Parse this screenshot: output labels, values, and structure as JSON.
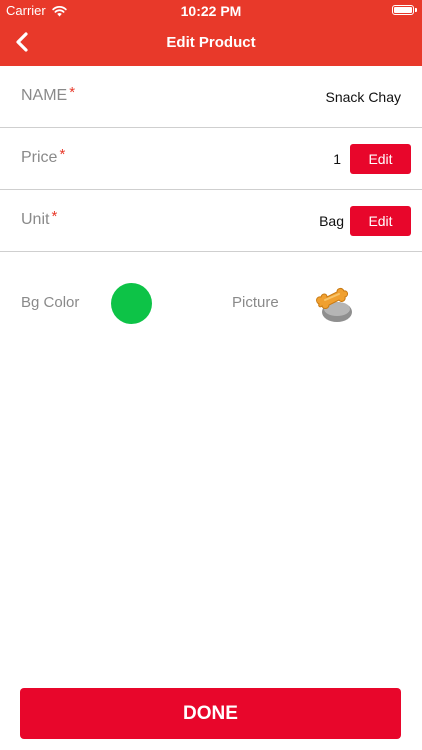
{
  "status_bar": {
    "carrier": "Carrier",
    "time": "10:22 PM",
    "icons": [
      "wifi-icon",
      "battery-icon"
    ]
  },
  "nav": {
    "title": "Edit Product",
    "back_icon": "chevron-left-icon"
  },
  "fields": {
    "name": {
      "label": "NAME",
      "required_mark": "*",
      "value": "Snack Chay"
    },
    "price": {
      "label": "Price",
      "required_mark": "*",
      "value": "1",
      "edit_label": "Edit"
    },
    "unit": {
      "label": "Unit",
      "required_mark": "*",
      "value": "Bag",
      "edit_label": "Edit"
    }
  },
  "appearance": {
    "bg_color_label": "Bg Color",
    "bg_color": "#0dc347",
    "picture_label": "Picture",
    "picture_icon": "snack-icon"
  },
  "done_label": "DONE",
  "colors": {
    "header": "#e8392a",
    "button": "#e8062b",
    "required": "#e8392a",
    "label": "#8a8a8a"
  }
}
